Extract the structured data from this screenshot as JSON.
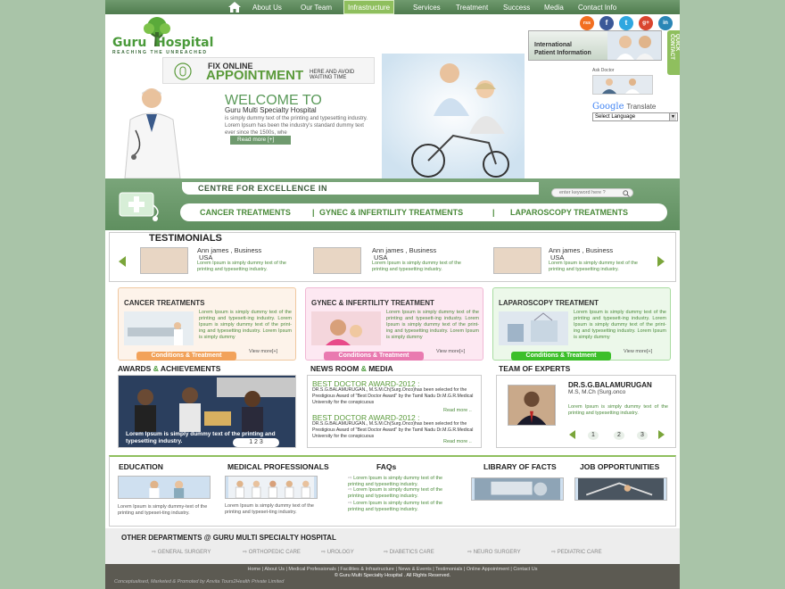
{
  "nav": {
    "items": [
      "About Us",
      "Our Team",
      "Infrastructure",
      "Services",
      "Treatment",
      "Success",
      "Media",
      "Contact Info"
    ],
    "active": "Infrastructure"
  },
  "logo": {
    "word1": "Guru",
    "word2": "Hospital",
    "tagline": "REACHING THE UNREACHED"
  },
  "social": {
    "rss": "rss",
    "facebook": "f",
    "twitter": "t",
    "google": "g+",
    "linkedin": "in"
  },
  "international": {
    "line1": "International",
    "line2": "Patient Information"
  },
  "quick_contact": "QUICK CONTACT",
  "appointment": {
    "line1": "FIX ONLINE",
    "line2": "APPOINTMENT",
    "line3": "HERE AND AVOID WAITING TIME"
  },
  "welcome": {
    "title": "WELCOME TO",
    "subtitle": "Guru Multi Specialty Hospital",
    "text": "is simply dummy text of the printing and typesetting industry. Lorem Ipsum has been the industry's standard dummy text ever since the 1500s, whe",
    "read_more": "Read more [+]"
  },
  "ask_doctor": "Ask Doctor",
  "google_translate": {
    "google": "Google",
    "translate": "Translate",
    "select": "Select Language"
  },
  "centre": {
    "title": "CENTRE FOR EXCELLENCE IN",
    "search_placeholder": "enter keyword here ?"
  },
  "treatments_bar": [
    "CANCER  TREATMENTS",
    "|",
    "GYNEC & INFERTILITY TREATMENTS",
    "|",
    "LAPAROSCOPY TREATMENTS"
  ],
  "testimonials": {
    "heading": "TESTIMONIALS",
    "items": [
      {
        "name": "Ann james , Business",
        "country": "USA",
        "text": "Lorem Ipsum is simply dummy text of the printing and typesetting industry."
      },
      {
        "name": "Ann james , Business",
        "country": "USA",
        "text": "Lorem Ipsum is simply dummy text of the printing and typesetting industry."
      },
      {
        "name": "Ann james , Business",
        "country": "USA",
        "text": "Lorem Ipsum is simply dummy text of the printing and typesetting industry."
      }
    ]
  },
  "treatment_cards": [
    {
      "title": "CANCER  TREATMENTS",
      "text": "Lorem Ipsum is simply dummy text of the printing and typesett-ing industry. Lorem Ipsum is simply dummy text of the print-ing and typesetting industry. Lorem Ipsum is simply dummy",
      "button": "Conditions & Treatment",
      "view_more": "View more[+]",
      "bg": "#fdf3ea",
      "btn_color": "#f2a25a"
    },
    {
      "title": "GYNEC & INFERTILITY TREATMENT",
      "text": "Lorem Ipsum is simply dummy text of the printing and typesett-ing industry. Lorem Ipsum is simply dummy text of the print-ing and typesetting industry. Lorem Ipsum is simply dummy",
      "button": "Conditions & Treatment",
      "view_more": "View more[+]",
      "bg": "#fde8f2",
      "btn_color": "#e97ab0"
    },
    {
      "title": "LAPAROSCOPY TREATMENT",
      "text": "Lorem Ipsum is simply dummy text of the printing and typesett-ing industry. Lorem Ipsum is simply dummy text of the print-ing and typesetting industry. Lorem Ipsum is simply dummy",
      "button": "Conditions & Treatment",
      "view_more": "View more[+]",
      "bg": "#ecf8ea",
      "btn_color": "#3cbf2a"
    }
  ],
  "awards": {
    "heading1": "AWARDS",
    "amp": "&",
    "heading2": "ACHIEVEMENTS",
    "caption": "Lorem Ipsum is simply dummy text of the printing and typesetting industry.",
    "pages": "1 2 3"
  },
  "news": {
    "heading1": "NEWS ROOM",
    "amp": "&",
    "heading2": "MEDIA",
    "items": [
      {
        "title": "BEST DOCTOR AWARD-2012 :",
        "text": "DR.S.G.BALAMURUGAN., M.S.M.Ch(Surg.Onco)has been selected for the Prestigious Award of \"Best Doctor Award\" by the Tamil Nadu Dr.M.G.R.Medical University for the conspicuous",
        "read_more": "Read more .."
      },
      {
        "title": "BEST DOCTOR AWARD-2012 :",
        "text": "DR.S.G.BALAMURUGAN., M.S.M.Ch(Surg.Onco)has been selected for the Prestigious Award of \"Best Doctor Award\" by the Tamil Nadu Dr.M.G.R.Medical University for the conspicuous",
        "read_more": "Read more .."
      }
    ]
  },
  "team": {
    "heading": "TEAM OF EXPERTS",
    "name": "DR.S.G.BALAMURUGAN",
    "degree": "M.S, M.Ch (Surg.onco",
    "text": "Lorem Ipsum is simply dummy text of the printing and typesetting industry.",
    "pages": [
      "1",
      "2",
      "3"
    ]
  },
  "lower": {
    "education": {
      "title": "EDUCATION",
      "text": "Lorem Ipsum is simply dummy-text of the printing and typeset-ting industry."
    },
    "medical": {
      "title": "MEDICAL PROFESSIONALS",
      "text": "Lorem Ipsum is simply dummy text of the printing and typeset-ting industry."
    },
    "faqs": {
      "title": "FAQs",
      "items": [
        "Lorem Ipsum is simply dummy text of the printing and typesetting industry.",
        "Lorem Ipsum is simply dummy text of the printing and typesetting industry.",
        "Lorem Ipsum is simply dummy text of the printing and typesetting industry."
      ]
    },
    "library": {
      "title": "LIBRARY OF FACTS"
    },
    "jobs": {
      "title": "JOB OPPORTUNITIES"
    }
  },
  "other_departments": {
    "heading": "OTHER DEPARTMENTS @ GURU MULTI SPECIALTY HOSPITAL",
    "items": [
      "GENERAL SURGERY",
      "ORTHOPEDIC CARE",
      "UROLOGY",
      "DIABETICS CARE",
      "NEURO SURGERY",
      "PEDIATRIC CARE"
    ]
  },
  "footer": {
    "links": "Home | About Us | Medical Professionals | Facilities & Infrastructure | News & Events | Testimonials | Online Appointment | Contact Us",
    "copyright": "© Guru Multi Specialty Hospital . All Rights Reserved.",
    "credit": "Conceptualised, Marketed & Promoted by Anvita Tours2Health Private Limited"
  },
  "colors": {
    "brand_green": "#5b9a5a",
    "nav": "#5f8b5e",
    "accent": "#8fbf5e"
  }
}
